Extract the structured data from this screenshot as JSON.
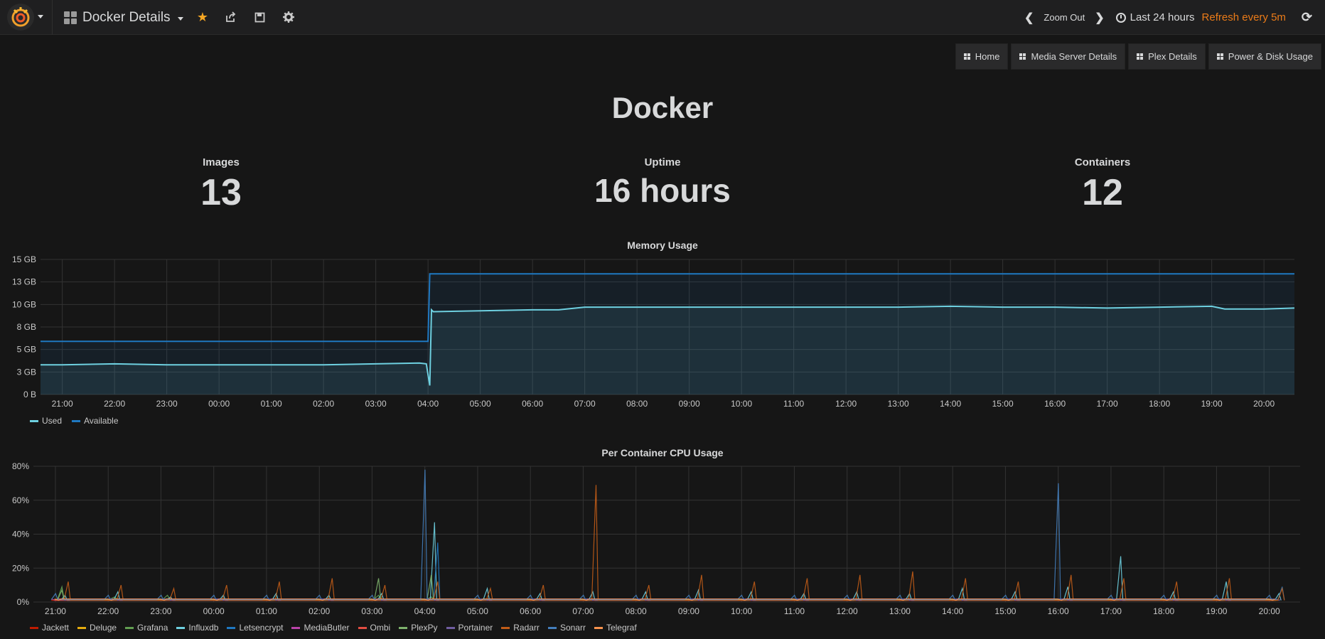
{
  "navbar": {
    "dashboard_title": "Docker Details",
    "zoom_out_label": "Zoom Out",
    "time_range_label": "Last 24 hours",
    "refresh_label": "Refresh every 5m"
  },
  "dash_links": [
    {
      "label": "Home"
    },
    {
      "label": "Media Server Details"
    },
    {
      "label": "Plex Details"
    },
    {
      "label": "Power & Disk Usage"
    }
  ],
  "main_title": "Docker",
  "stats": {
    "images": {
      "label": "Images",
      "value": "13"
    },
    "uptime": {
      "label": "Uptime",
      "value": "16 hours"
    },
    "containers": {
      "label": "Containers",
      "value": "12"
    }
  },
  "colors": {
    "used": "#6ed0e0",
    "available": "#1f78c1",
    "accent_orange": "#eb7b18",
    "star": "#f5a623"
  },
  "chart_data": [
    {
      "type": "area",
      "title": "Memory Usage",
      "x_ticks": [
        "21:00",
        "22:00",
        "23:00",
        "00:00",
        "01:00",
        "02:00",
        "03:00",
        "04:00",
        "05:00",
        "06:00",
        "07:00",
        "08:00",
        "09:00",
        "10:00",
        "11:00",
        "12:00",
        "13:00",
        "14:00",
        "15:00",
        "16:00",
        "17:00",
        "18:00",
        "19:00",
        "20:00"
      ],
      "y_ticks": [
        "0 B",
        "3 GB",
        "5 GB",
        "8 GB",
        "10 GB",
        "13 GB",
        "15 GB"
      ],
      "y_unit": "GB",
      "ylim": [
        0,
        15
      ],
      "series": [
        {
          "name": "Used",
          "color": "#6ed0e0",
          "x": [
            "20:35",
            "21:00",
            "22:00",
            "23:00",
            "00:00",
            "01:00",
            "02:00",
            "03:00",
            "03:50",
            "03:58",
            "04:02",
            "04:04",
            "04:06",
            "05:00",
            "06:00",
            "06:30",
            "07:00",
            "08:00",
            "09:00",
            "10:00",
            "11:00",
            "12:00",
            "13:00",
            "14:00",
            "15:00",
            "16:00",
            "17:00",
            "18:00",
            "19:00",
            "19:15",
            "20:00",
            "20:35"
          ],
          "values": [
            3.3,
            3.3,
            3.4,
            3.3,
            3.3,
            3.3,
            3.3,
            3.4,
            3.5,
            3.4,
            1.0,
            9.4,
            9.2,
            9.3,
            9.4,
            9.4,
            9.7,
            9.7,
            9.7,
            9.7,
            9.7,
            9.7,
            9.7,
            9.8,
            9.7,
            9.7,
            9.6,
            9.7,
            9.8,
            9.5,
            9.5,
            9.6
          ]
        },
        {
          "name": "Available",
          "color": "#1f78c1",
          "x": [
            "20:35",
            "04:00",
            "04:02",
            "20:35"
          ],
          "values": [
            5.9,
            5.9,
            13.4,
            13.4
          ]
        }
      ],
      "legend": [
        "Used",
        "Available"
      ]
    },
    {
      "type": "line",
      "title": "Per Container CPU Usage",
      "x_ticks": [
        "21:00",
        "22:00",
        "23:00",
        "00:00",
        "01:00",
        "02:00",
        "03:00",
        "04:00",
        "05:00",
        "06:00",
        "07:00",
        "08:00",
        "09:00",
        "10:00",
        "11:00",
        "12:00",
        "13:00",
        "14:00",
        "15:00",
        "16:00",
        "17:00",
        "18:00",
        "19:00",
        "20:00"
      ],
      "y_ticks": [
        "0%",
        "20%",
        "40%",
        "60%",
        "80%"
      ],
      "ylim": [
        0,
        80
      ],
      "series": [
        {
          "name": "Jackett",
          "color": "#bf1b00",
          "values": [
            1,
            1,
            1,
            2,
            1,
            1,
            1,
            1,
            1,
            1,
            1,
            1,
            1,
            1,
            1,
            1,
            1,
            1,
            1,
            1,
            1,
            1,
            1,
            1
          ]
        },
        {
          "name": "Deluge",
          "color": "#e5ac0e",
          "values": [
            2,
            1,
            1,
            1,
            1,
            1,
            1,
            2,
            1,
            1,
            1,
            1,
            1,
            1,
            1,
            1,
            1,
            1,
            1,
            1,
            1,
            1,
            1,
            1
          ]
        },
        {
          "name": "Grafana",
          "color": "#629e51",
          "values": [
            9,
            3,
            4,
            1,
            1,
            1,
            4,
            3,
            1,
            1,
            1,
            1,
            1,
            1,
            1,
            1,
            1,
            1,
            1,
            1,
            1,
            1,
            1,
            1
          ]
        },
        {
          "name": "Influxdb",
          "color": "#6ed0e0",
          "values": [
            4,
            6,
            3,
            4,
            5,
            4,
            5,
            47,
            8,
            5,
            6,
            6,
            7,
            6,
            5,
            6,
            5,
            8,
            6,
            9,
            27,
            6,
            12,
            5
          ]
        },
        {
          "name": "Letsencrypt",
          "color": "#1f78c1",
          "values": [
            2,
            1,
            1,
            1,
            1,
            1,
            1,
            35,
            2,
            1,
            1,
            1,
            1,
            1,
            1,
            1,
            1,
            1,
            1,
            1,
            1,
            1,
            1,
            9
          ]
        },
        {
          "name": "MediaButler",
          "color": "#ba43a9",
          "values": [
            1,
            1,
            1,
            1,
            1,
            1,
            1,
            1,
            1,
            1,
            1,
            1,
            1,
            1,
            1,
            1,
            1,
            1,
            1,
            1,
            1,
            1,
            1,
            1
          ]
        },
        {
          "name": "Ombi",
          "color": "#e24d42",
          "values": [
            1,
            1,
            1,
            1,
            1,
            1,
            1,
            1,
            1,
            1,
            1,
            1,
            1,
            1,
            1,
            1,
            1,
            1,
            1,
            1,
            1,
            1,
            1,
            1
          ]
        },
        {
          "name": "PlexPy",
          "color": "#7eb26d",
          "values": [
            7,
            2,
            2,
            1,
            1,
            1,
            14,
            16,
            2,
            1,
            1,
            1,
            1,
            1,
            1,
            1,
            1,
            1,
            1,
            1,
            1,
            1,
            1,
            1
          ]
        },
        {
          "name": "Portainer",
          "color": "#705da0",
          "values": [
            1,
            1,
            1,
            1,
            1,
            1,
            1,
            1,
            1,
            1,
            1,
            1,
            1,
            1,
            1,
            1,
            1,
            1,
            1,
            1,
            1,
            1,
            1,
            1
          ]
        },
        {
          "name": "Radarr",
          "color": "#c15c17",
          "values": [
            12,
            10,
            8,
            10,
            12,
            14,
            10,
            12,
            8,
            10,
            69,
            10,
            16,
            12,
            14,
            16,
            18,
            14,
            12,
            16,
            14,
            12,
            14,
            8
          ]
        },
        {
          "name": "Sonarr",
          "color": "#447ebc",
          "values": [
            5,
            4,
            4,
            4,
            4,
            4,
            4,
            78,
            4,
            4,
            4,
            4,
            4,
            4,
            4,
            4,
            4,
            4,
            4,
            70,
            4,
            4,
            4,
            4
          ]
        },
        {
          "name": "Telegraf",
          "color": "#f9934e",
          "values": [
            1,
            1,
            1,
            1,
            1,
            1,
            1,
            1,
            1,
            1,
            1,
            1,
            1,
            1,
            1,
            1,
            1,
            1,
            1,
            1,
            1,
            1,
            1,
            1
          ]
        }
      ]
    }
  ]
}
